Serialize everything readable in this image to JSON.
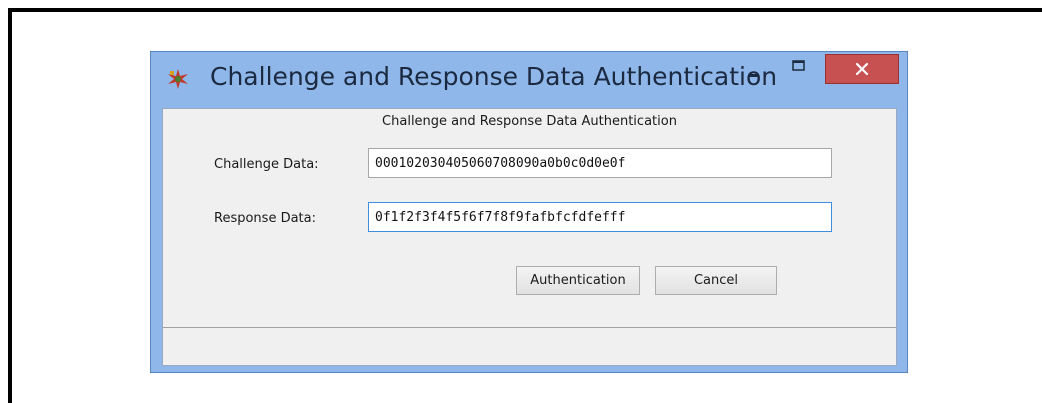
{
  "window": {
    "title": "Challenge and Response Data Authentication",
    "icon": "puzzle-star-icon",
    "controls": {
      "minimize": "minimize-icon",
      "maximize": "maximize-icon",
      "close": "close-icon"
    }
  },
  "form": {
    "header": "Challenge and Response Data Authentication",
    "challenge": {
      "label": "Challenge Data:",
      "value": "000102030405060708090a0b0c0d0e0f"
    },
    "response": {
      "label": "Response Data:",
      "value": "0f1f2f3f4f5f6f7f8f9fafbfcfdfefff"
    }
  },
  "buttons": {
    "authenticate": "Authentication",
    "cancel": "Cancel"
  },
  "colors": {
    "titlebar": "#8fb7ea",
    "close_button": "#c75050",
    "client": "#f0f0f0",
    "focus_border": "#3f8ee0"
  }
}
